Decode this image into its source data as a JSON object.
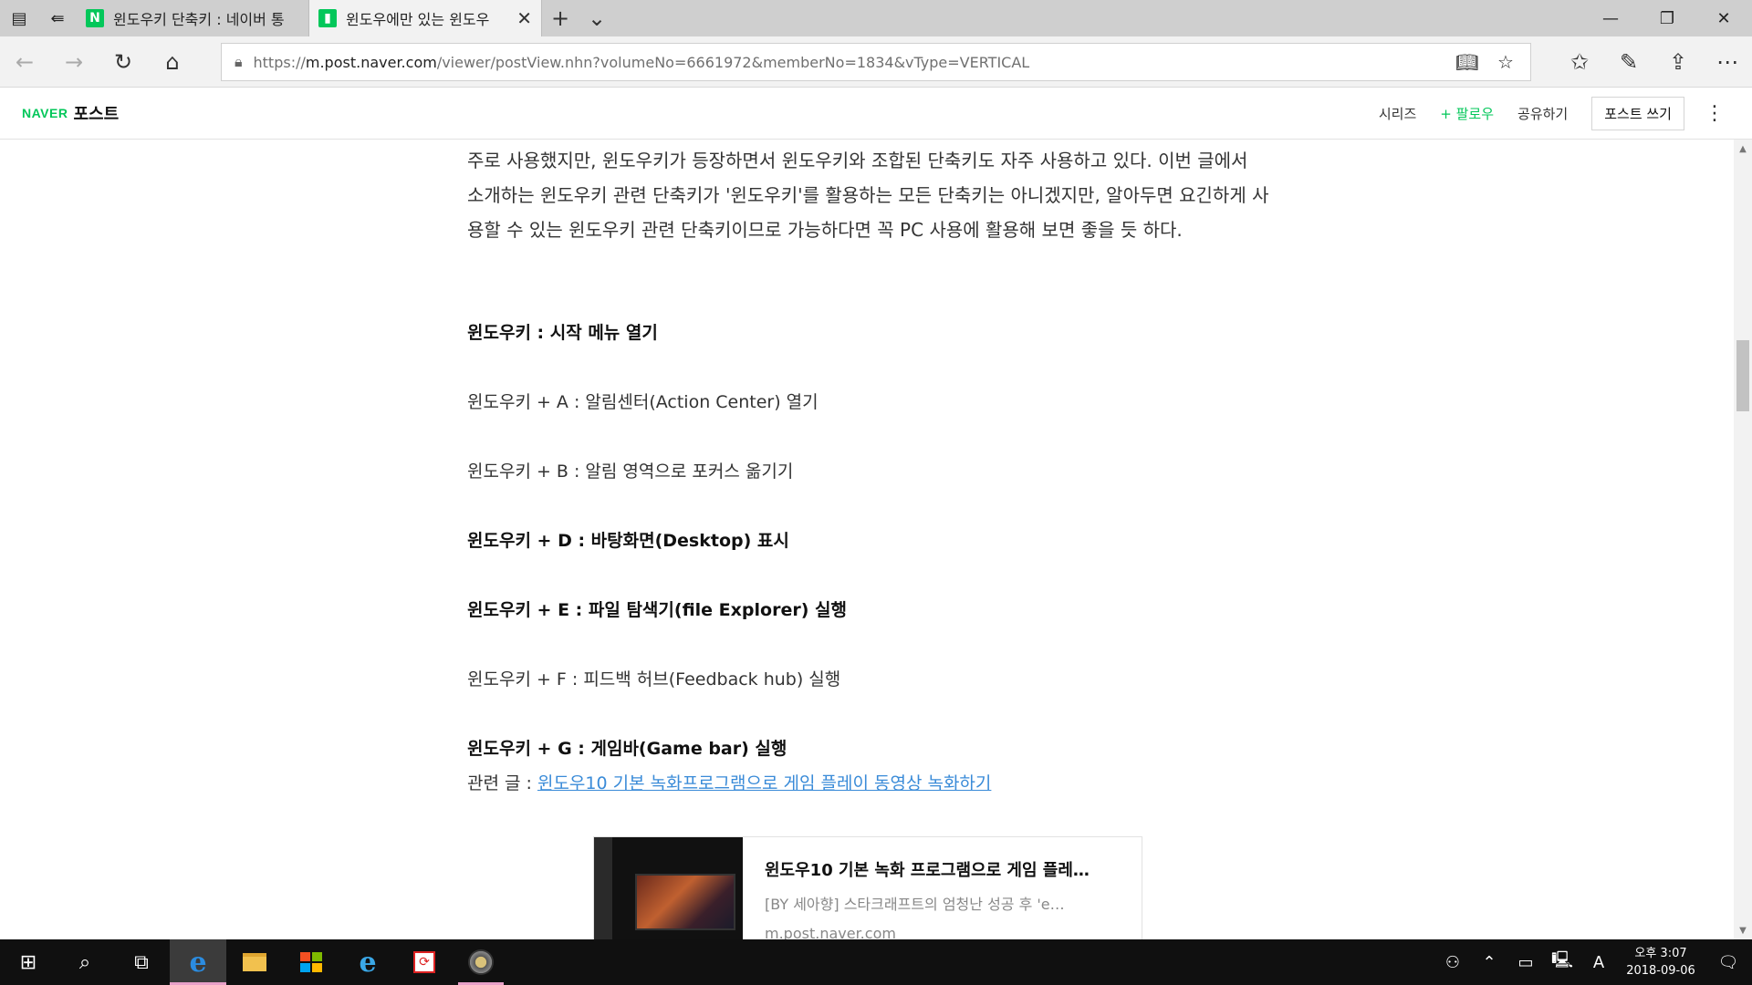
{
  "browser": {
    "tabs": [
      {
        "favicon": "N",
        "title": "윈도우키 단축키 : 네이버 통",
        "active": false
      },
      {
        "favicon": "▮",
        "title": "윈도우에만 있는 윈도우",
        "active": true
      }
    ],
    "url": {
      "scheme": "https://",
      "host": "m.post.naver.com",
      "rest": "/viewer/postView.nhn?volumeNo=6661972&memberNo=1834&vType=VERTICAL"
    }
  },
  "site": {
    "logo_naver": "NAVER",
    "logo_post": "포스트",
    "series": "시리즈",
    "follow": "+ 팔로우",
    "share": "공유하기",
    "write": "포스트 쓰기"
  },
  "article": {
    "intro": "주로 사용했지만, 윈도우키가 등장하면서 윈도우키와 조합된 단축키도 자주 사용하고 있다. 이번 글에서 소개하는 윈도우키 관련 단축키가 '윈도우키'를 활용하는 모든 단축키는 아니겠지만, 알아두면 요긴하게 사용할 수 있는 윈도우키 관련 단축키이므로 가능하다면 꼭 PC 사용에 활용해 보면 좋을 듯 하다.",
    "lines": [
      {
        "text": "윈도우키 : 시작 메뉴 열기",
        "bold": true
      },
      {
        "text": "윈도우키 + A : 알림센터(Action Center) 열기",
        "bold": false
      },
      {
        "text": "윈도우키 + B : 알림 영역으로 포커스 옮기기",
        "bold": false
      },
      {
        "text": "윈도우키 + D : 바탕화면(Desktop) 표시",
        "bold": true
      },
      {
        "text": "윈도우키 + E : 파일 탐색기(file Explorer) 실행",
        "bold": true
      },
      {
        "text": "윈도우키 + F : 피드백 허브(Feedback hub) 실행",
        "bold": false
      },
      {
        "text": "윈도우키 + G : 게임바(Game bar) 실행",
        "bold": true
      }
    ],
    "related_prefix": "관련 글 : ",
    "related_link": "윈도우10 기본 녹화프로그램으로 게임 플레이 동영상 녹화하기",
    "card": {
      "title": "윈도우10 기본 녹화 프로그램으로 게임 플레…",
      "desc": "[BY 세아향] 스타크래프트의 엄청난 성공 후 'e…",
      "url": "m.post.naver.com"
    }
  },
  "taskbar": {
    "clock_time": "오후 3:07",
    "clock_date": "2018-09-06",
    "ime": "A"
  },
  "colors": {
    "naver_green": "#03c75a",
    "link_blue": "#3a8bd8",
    "taskbar_bg": "#101010"
  },
  "icons": [
    "tab-list-icon",
    "set-aside-tabs-icon",
    "close-icon",
    "plus-icon",
    "chevron-down-icon",
    "minimize-icon",
    "restore-icon",
    "back-icon",
    "forward-icon",
    "refresh-icon",
    "home-icon",
    "lock-icon",
    "reading-view-icon",
    "star-icon",
    "favorites-icon",
    "pen-icon",
    "share-icon",
    "more-icon",
    "windows-icon",
    "search-icon",
    "task-view-icon",
    "edge-icon",
    "folder-icon",
    "store-icon",
    "ie-icon",
    "sync-app-icon",
    "settings-app-icon",
    "people-icon",
    "chevron-up-icon",
    "battery-icon",
    "network-icon",
    "notification-icon"
  ]
}
